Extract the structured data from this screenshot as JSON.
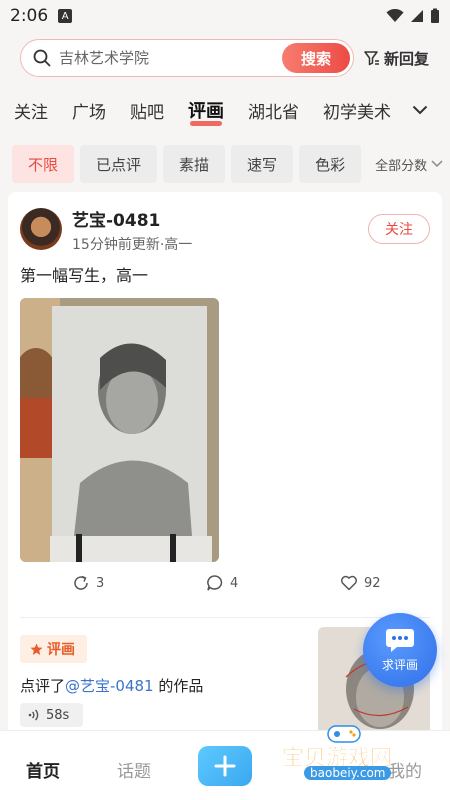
{
  "status_bar": {
    "time": "2:06",
    "sim_label": "A"
  },
  "search": {
    "placeholder": "吉林艺术学院",
    "button_label": "搜索",
    "new_reply_label": "新回复"
  },
  "tabs": [
    "关注",
    "广场",
    "贴吧",
    "评画",
    "湖北省",
    "初学美术"
  ],
  "active_tab": "评画",
  "filters": {
    "chips": [
      "不限",
      "已点评",
      "素描",
      "速写",
      "色彩"
    ],
    "active_chip": "不限",
    "score_label": "全部分数"
  },
  "post": {
    "author": "艺宝-0481",
    "meta": "15分钟前更新·高一",
    "follow_label": "关注",
    "text": "第一幅写生，高一",
    "reposts": "3",
    "comments": "4",
    "likes": "92"
  },
  "review": {
    "tag_label": "评画",
    "text_prefix": "点评了",
    "mention": "@艺宝-0481",
    "text_suffix": " 的作品",
    "voice_duration": "58s"
  },
  "fab": {
    "label": "求评画"
  },
  "bottom_nav": {
    "home": "首页",
    "topics": "话题",
    "mine": "我的"
  },
  "watermark": {
    "title": "宝贝游戏网",
    "url": "baobeiy.com"
  },
  "colors": {
    "accent": "#ec4b45",
    "fab": "#2f6fe8",
    "mention": "#3b74c9"
  }
}
